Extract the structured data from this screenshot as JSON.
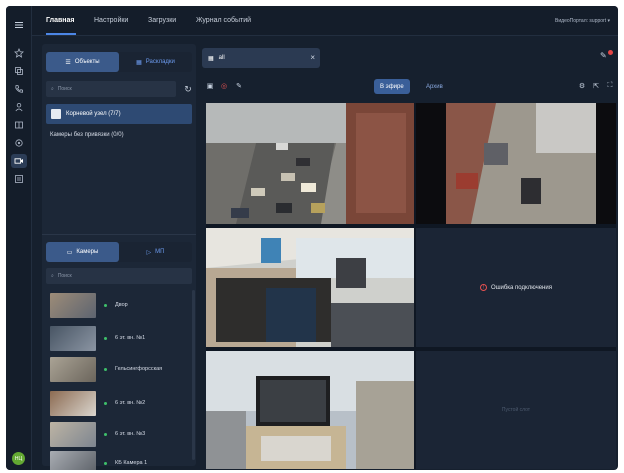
{
  "topbar": {
    "nav": [
      "Главная",
      "Настройки",
      "Загрузки",
      "Журнал событий"
    ],
    "user": "ВидеоПортал: support ▾"
  },
  "rail": {
    "icons": [
      "menu-icon",
      "star-icon",
      "layout-icon",
      "phone-icon",
      "user-icon",
      "map-icon",
      "location-icon",
      "camera-icon",
      "archive-icon"
    ],
    "avatar": "НЦ"
  },
  "leftpanel": {
    "tabs": [
      {
        "label": "Объекты",
        "icon": "objects-icon"
      },
      {
        "label": "Раскладки",
        "icon": "layouts-icon"
      }
    ],
    "search_placeholder": "Поиск",
    "root_node": "Корневой узел (7/7)",
    "unbound": "Камеры без привязки (0/0)",
    "cam_tabs": [
      {
        "label": "Камеры",
        "icon": "camera-icon"
      },
      {
        "label": "МП",
        "icon": "play-icon"
      }
    ],
    "cam_search_placeholder": "Поиск",
    "cameras": [
      {
        "name": "Двор",
        "thumb": "#8a7a66"
      },
      {
        "name": "6 эт. вн. №1",
        "thumb": "#5f6a78"
      },
      {
        "name": "Гельсингфорсская",
        "thumb": "#8b8478"
      },
      {
        "name": "6 эт. вн. №2",
        "thumb": "#6f5948"
      },
      {
        "name": "6 эт. вн. №3",
        "thumb": "#a59c8c"
      },
      {
        "name": "КБ Камера 1",
        "thumb": "#8f949c"
      }
    ]
  },
  "main": {
    "tab_label": "all",
    "modes": [
      "В эфире",
      "Архив"
    ],
    "error_text": "Ошибка подключения",
    "empty_text": "Пустой слот",
    "colors": {
      "accent": "#3a5f99",
      "error": "#e65151",
      "online": "#3ec06a"
    }
  }
}
